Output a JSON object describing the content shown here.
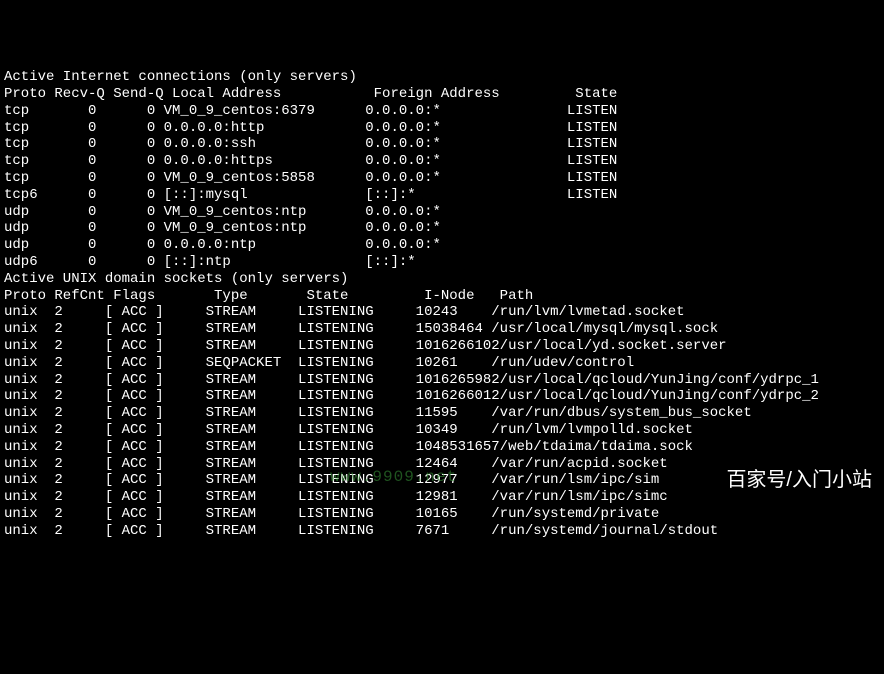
{
  "header_inet": "Active Internet connections (only servers)",
  "inet_columns": "Proto Recv-Q Send-Q Local Address           Foreign Address         State",
  "inet_rows": [
    {
      "proto": "tcp",
      "recvq": "0",
      "sendq": "0",
      "local": "VM_0_9_centos:6379",
      "foreign": "0.0.0.0:*",
      "state": "LISTEN"
    },
    {
      "proto": "tcp",
      "recvq": "0",
      "sendq": "0",
      "local": "0.0.0.0:http",
      "foreign": "0.0.0.0:*",
      "state": "LISTEN"
    },
    {
      "proto": "tcp",
      "recvq": "0",
      "sendq": "0",
      "local": "0.0.0.0:ssh",
      "foreign": "0.0.0.0:*",
      "state": "LISTEN"
    },
    {
      "proto": "tcp",
      "recvq": "0",
      "sendq": "0",
      "local": "0.0.0.0:https",
      "foreign": "0.0.0.0:*",
      "state": "LISTEN"
    },
    {
      "proto": "tcp",
      "recvq": "0",
      "sendq": "0",
      "local": "VM_0_9_centos:5858",
      "foreign": "0.0.0.0:*",
      "state": "LISTEN"
    },
    {
      "proto": "tcp6",
      "recvq": "0",
      "sendq": "0",
      "local": "[::]:mysql",
      "foreign": "[::]:*",
      "state": "LISTEN"
    },
    {
      "proto": "udp",
      "recvq": "0",
      "sendq": "0",
      "local": "VM_0_9_centos:ntp",
      "foreign": "0.0.0.0:*",
      "state": ""
    },
    {
      "proto": "udp",
      "recvq": "0",
      "sendq": "0",
      "local": "VM_0_9_centos:ntp",
      "foreign": "0.0.0.0:*",
      "state": ""
    },
    {
      "proto": "udp",
      "recvq": "0",
      "sendq": "0",
      "local": "0.0.0.0:ntp",
      "foreign": "0.0.0.0:*",
      "state": ""
    },
    {
      "proto": "udp6",
      "recvq": "0",
      "sendq": "0",
      "local": "[::]:ntp",
      "foreign": "[::]:*",
      "state": ""
    }
  ],
  "header_unix": "Active UNIX domain sockets (only servers)",
  "unix_columns": "Proto RefCnt Flags       Type       State         I-Node   Path",
  "unix_rows": [
    {
      "proto": "unix",
      "refcnt": "2",
      "flags": "[ ACC ]",
      "type": "STREAM",
      "state": "LISTENING",
      "inode": "10243",
      "path": "/run/lvm/lvmetad.socket"
    },
    {
      "proto": "unix",
      "refcnt": "2",
      "flags": "[ ACC ]",
      "type": "STREAM",
      "state": "LISTENING",
      "inode": "15038464",
      "path": "/usr/local/mysql/mysql.sock"
    },
    {
      "proto": "unix",
      "refcnt": "2",
      "flags": "[ ACC ]",
      "type": "STREAM",
      "state": "LISTENING",
      "inode": "1016266102",
      "path": "/usr/local/yd.socket.server"
    },
    {
      "proto": "unix",
      "refcnt": "2",
      "flags": "[ ACC ]",
      "type": "SEQPACKET",
      "state": "LISTENING",
      "inode": "10261",
      "path": "/run/udev/control"
    },
    {
      "proto": "unix",
      "refcnt": "2",
      "flags": "[ ACC ]",
      "type": "STREAM",
      "state": "LISTENING",
      "inode": "1016265982",
      "path": "/usr/local/qcloud/YunJing/conf/ydrpc_1"
    },
    {
      "proto": "unix",
      "refcnt": "2",
      "flags": "[ ACC ]",
      "type": "STREAM",
      "state": "LISTENING",
      "inode": "1016266012",
      "path": "/usr/local/qcloud/YunJing/conf/ydrpc_2"
    },
    {
      "proto": "unix",
      "refcnt": "2",
      "flags": "[ ACC ]",
      "type": "STREAM",
      "state": "LISTENING",
      "inode": "11595",
      "path": "/var/run/dbus/system_bus_socket"
    },
    {
      "proto": "unix",
      "refcnt": "2",
      "flags": "[ ACC ]",
      "type": "STREAM",
      "state": "LISTENING",
      "inode": "10349",
      "path": "/run/lvm/lvmpolld.socket"
    },
    {
      "proto": "unix",
      "refcnt": "2",
      "flags": "[ ACC ]",
      "type": "STREAM",
      "state": "LISTENING",
      "inode": "1048531657",
      "path": "/web/tdaima/tdaima.sock"
    },
    {
      "proto": "unix",
      "refcnt": "2",
      "flags": "[ ACC ]",
      "type": "STREAM",
      "state": "LISTENING",
      "inode": "12464",
      "path": "/var/run/acpid.socket"
    },
    {
      "proto": "unix",
      "refcnt": "2",
      "flags": "[ ACC ]",
      "type": "STREAM",
      "state": "LISTENING",
      "inode": "12977",
      "path": "/var/run/lsm/ipc/sim"
    },
    {
      "proto": "unix",
      "refcnt": "2",
      "flags": "[ ACC ]",
      "type": "STREAM",
      "state": "LISTENING",
      "inode": "12981",
      "path": "/var/run/lsm/ipc/simc"
    },
    {
      "proto": "unix",
      "refcnt": "2",
      "flags": "[ ACC ]",
      "type": "STREAM",
      "state": "LISTENING",
      "inode": "10165",
      "path": "/run/systemd/private"
    },
    {
      "proto": "unix",
      "refcnt": "2",
      "flags": "[ ACC ]",
      "type": "STREAM",
      "state": "LISTENING",
      "inode": "7671",
      "path": "/run/systemd/journal/stdout"
    }
  ],
  "watermark_green": "www.9909.net",
  "watermark_white": "百家号/入门小站"
}
